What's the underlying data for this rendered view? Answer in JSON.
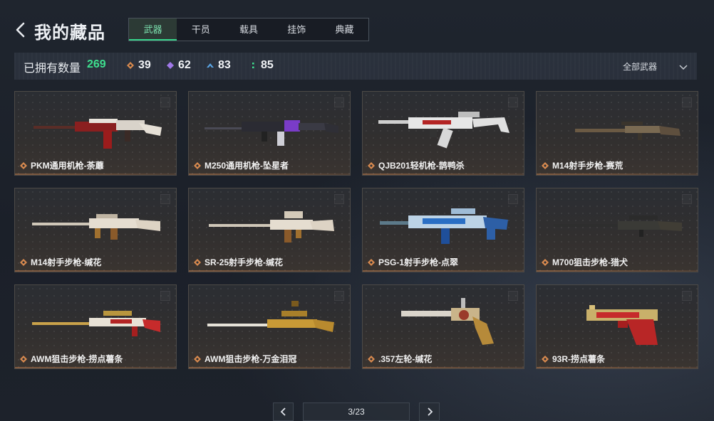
{
  "header": {
    "title": "我的藏品",
    "tabs": [
      {
        "label": "武器",
        "active": true
      },
      {
        "label": "干员",
        "active": false
      },
      {
        "label": "载具",
        "active": false
      },
      {
        "label": "挂饰",
        "active": false
      },
      {
        "label": "典藏",
        "active": false
      }
    ]
  },
  "stats": {
    "owned_label": "已拥有数量",
    "owned_count": "269",
    "tiers": [
      {
        "icon": "orange-diamond-icon",
        "color": "#d98a4e",
        "count": "39"
      },
      {
        "icon": "purple-diamond-icon",
        "color": "#a078e8",
        "count": "62"
      },
      {
        "icon": "blue-arrow-icon",
        "color": "#5aa6e6",
        "count": "83"
      },
      {
        "icon": "green-dots-icon",
        "color": "#3ee08f",
        "count": "85"
      }
    ],
    "filter_label": "全部武器"
  },
  "items": [
    {
      "name": "PKM通用机枪-荼蘼",
      "rarity_color": "#d98a4e"
    },
    {
      "name": "M250通用机枪-坠星者",
      "rarity_color": "#d98a4e"
    },
    {
      "name": "QJB201轻机枪-鹊鸭杀",
      "rarity_color": "#d98a4e"
    },
    {
      "name": "M14射手步枪-赛荒",
      "rarity_color": "#d98a4e"
    },
    {
      "name": "M14射手步枪-缄花",
      "rarity_color": "#d98a4e"
    },
    {
      "name": "SR-25射手步枪-缄花",
      "rarity_color": "#d98a4e"
    },
    {
      "name": "PSG-1射手步枪-点翠",
      "rarity_color": "#d98a4e"
    },
    {
      "name": "M700狙击步枪-猎犬",
      "rarity_color": "#d98a4e"
    },
    {
      "name": "AWM狙击步枪-捞点薯条",
      "rarity_color": "#d98a4e"
    },
    {
      "name": "AWM狙击步枪-万金泪冠",
      "rarity_color": "#d98a4e"
    },
    {
      "name": ".357左轮-缄花",
      "rarity_color": "#d98a4e"
    },
    {
      "name": "93R-捞点薯条",
      "rarity_color": "#d98a4e"
    }
  ],
  "pagination": {
    "page_text": "3/23"
  }
}
